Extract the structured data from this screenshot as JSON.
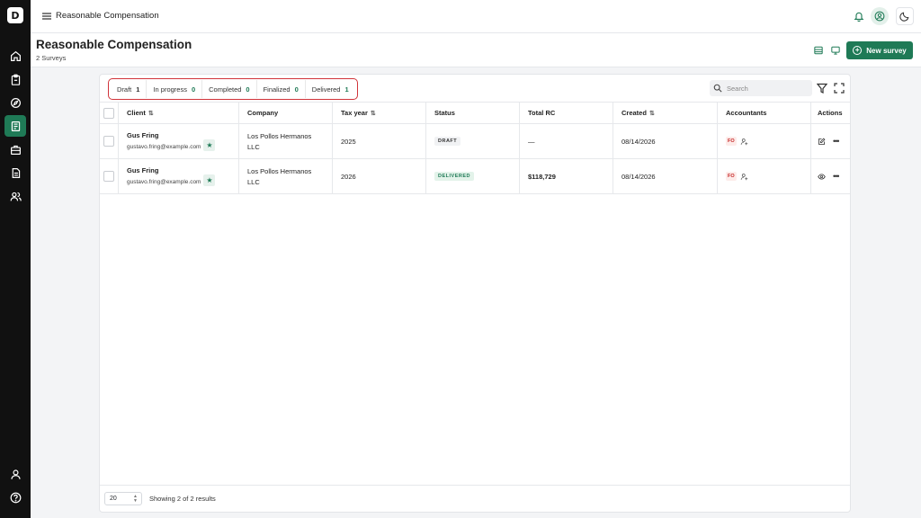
{
  "app": {
    "logo_text": "D",
    "title": "Reasonable Compensation"
  },
  "sidebar": {
    "items": [
      {
        "name": "home-icon"
      },
      {
        "name": "clipboard-icon"
      },
      {
        "name": "compass-icon"
      },
      {
        "name": "survey-icon",
        "active": true
      },
      {
        "name": "briefcase-icon"
      },
      {
        "name": "document-icon"
      },
      {
        "name": "users-icon"
      }
    ],
    "bottom": [
      {
        "name": "user-icon"
      },
      {
        "name": "help-icon"
      }
    ]
  },
  "header": {
    "title": "Reasonable Compensation",
    "subtitle": "2 Surveys",
    "new_button": "New survey"
  },
  "tabs": [
    {
      "label": "Draft",
      "count": "1"
    },
    {
      "label": "In progress",
      "count": "0"
    },
    {
      "label": "Completed",
      "count": "0"
    },
    {
      "label": "Finalized",
      "count": "0"
    },
    {
      "label": "Delivered",
      "count": "1"
    }
  ],
  "search": {
    "placeholder": "Search"
  },
  "table": {
    "columns": [
      "Client",
      "Company",
      "Tax year",
      "Status",
      "Total RC",
      "Created",
      "Accountants",
      "Actions"
    ],
    "rows": [
      {
        "client_name": "Gus Fring",
        "client_email": "gustavo.fring@example.com",
        "company_line1": "Los Pollos Hermanos",
        "company_line2": "LLC",
        "tax_year": "2025",
        "status": "DRAFT",
        "total_rc": "—",
        "created": "08/14/2026",
        "accountant": "FO"
      },
      {
        "client_name": "Gus Fring",
        "client_email": "gustavo.fring@example.com",
        "company_line1": "Los Pollos Hermanos",
        "company_line2": "LLC",
        "tax_year": "2026",
        "status": "DELIVERED",
        "total_rc": "$118,729",
        "created": "08/14/2026",
        "accountant": "FO"
      }
    ]
  },
  "footer": {
    "page_size": "20",
    "results": "Showing 2 of 2 results"
  },
  "colors": {
    "accent": "#1f7a56",
    "tab_highlight": "#d1343a",
    "sidebar_bg": "#111111"
  }
}
